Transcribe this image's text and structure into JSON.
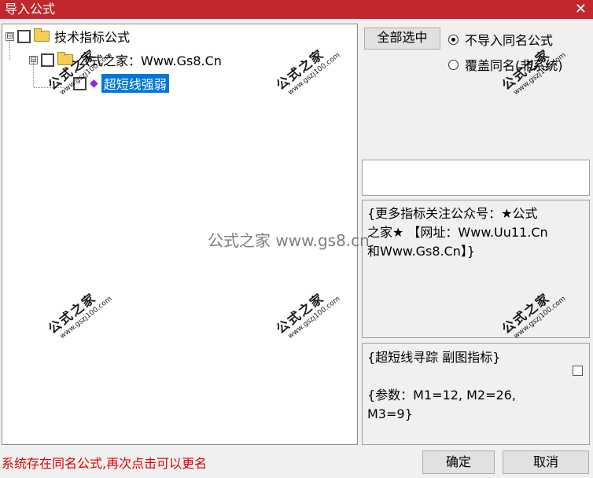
{
  "window": {
    "title": "导入公式",
    "close_glyph": "✕"
  },
  "tree": {
    "root": {
      "expander": "⊟",
      "label": "技术指标公式"
    },
    "group": {
      "expander": "⊟",
      "label": "公式之家：Www.Gs8.Cn"
    },
    "item": {
      "label": "超短线强弱",
      "selected": true
    }
  },
  "options": {
    "select_all_label": "全部选中",
    "radio_no_import": {
      "label": "不导入同名公式",
      "checked": true
    },
    "radio_overwrite": {
      "label": "覆盖同名(非系统)",
      "checked": false
    }
  },
  "info": {
    "lines": [
      "{更多指标关注公众号：★公式",
      "之家★ 【网址：Www.Uu11.Cn",
      "和Www.Gs8.Cn】}"
    ]
  },
  "description": {
    "line1": "{超短线寻踪 副图指标}",
    "line2": "",
    "line3": "{参数：M1=12, M2=26,",
    "line4": "M3=9}"
  },
  "status_text": "系统存在同名公式,再次点击可以更名",
  "buttons": {
    "ok": "确定",
    "cancel": "取消"
  },
  "watermark": {
    "brand": "公式之家",
    "url": "www.gszj100.com",
    "center": "公式之家 www.gs8.cn"
  },
  "colors": {
    "titlebar": "#c1272d",
    "selection": "#0078d7",
    "status": "#e00000"
  }
}
